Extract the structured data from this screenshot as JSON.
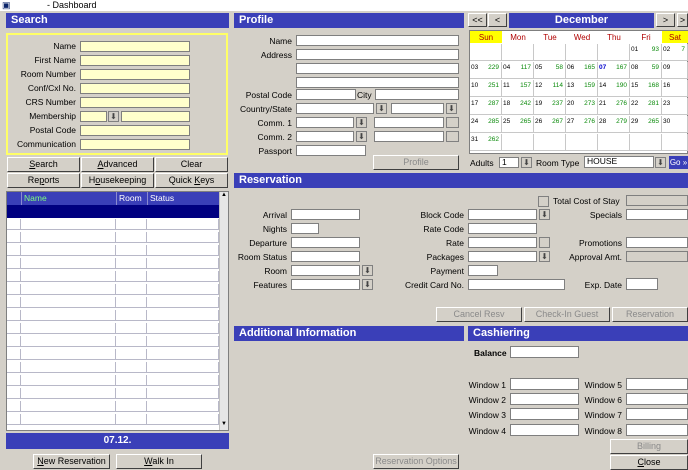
{
  "window": {
    "title": "- Dashboard"
  },
  "search": {
    "header": "Search",
    "labels": [
      "Name",
      "First Name",
      "Room Number",
      "Conf/Cxl No.",
      "CRS Number",
      "Membership",
      "Postal Code",
      "Communication"
    ],
    "buttons": {
      "search": "Search",
      "advanced": "Advanced",
      "clear": "Clear",
      "reports": "Reports",
      "housekeeping": "Housekeeping",
      "quick_keys": "Quick Keys"
    },
    "columns": [
      "Name",
      "Room",
      "Status"
    ],
    "date_bar": "07.12.",
    "new_reservation": "New Reservation",
    "walk_in": "Walk In"
  },
  "profile": {
    "header": "Profile",
    "labels": {
      "name": "Name",
      "address": "Address",
      "postal_code": "Postal Code",
      "city": "City",
      "country_state": "Country/State",
      "comm1": "Comm. 1",
      "comm2": "Comm. 2",
      "passport": "Passport"
    },
    "button": "Profile"
  },
  "calendar": {
    "prev_prev": "<<",
    "prev": "<",
    "month": "December",
    "next": ">",
    "next_next": ">",
    "dow": [
      "Sun",
      "Mon",
      "Tue",
      "Wed",
      "Thu",
      "Fri",
      "Sat"
    ],
    "weeks": [
      [
        [
          "",
          ""
        ],
        [
          "",
          ""
        ],
        [
          "",
          ""
        ],
        [
          "",
          ""
        ],
        [
          "",
          ""
        ],
        [
          "01",
          "93"
        ],
        [
          "02",
          "7"
        ]
      ],
      [
        [
          "03",
          "229"
        ],
        [
          "04",
          "117"
        ],
        [
          "05",
          "58"
        ],
        [
          "06",
          "165"
        ],
        [
          "07",
          "167"
        ],
        [
          "08",
          "59"
        ],
        [
          "09",
          ""
        ]
      ],
      [
        [
          "10",
          "251"
        ],
        [
          "11",
          "157"
        ],
        [
          "12",
          "114"
        ],
        [
          "13",
          "159"
        ],
        [
          "14",
          "190"
        ],
        [
          "15",
          "168"
        ],
        [
          "16",
          ""
        ]
      ],
      [
        [
          "17",
          "287"
        ],
        [
          "18",
          "242"
        ],
        [
          "19",
          "237"
        ],
        [
          "20",
          "273"
        ],
        [
          "21",
          "276"
        ],
        [
          "22",
          "281"
        ],
        [
          "23",
          ""
        ]
      ],
      [
        [
          "24",
          "285"
        ],
        [
          "25",
          "265"
        ],
        [
          "26",
          "267"
        ],
        [
          "27",
          "276"
        ],
        [
          "28",
          "279"
        ],
        [
          "29",
          "265"
        ],
        [
          "30",
          ""
        ]
      ],
      [
        [
          "31",
          "262"
        ],
        [
          "",
          ""
        ],
        [
          "",
          ""
        ],
        [
          "",
          ""
        ],
        [
          "",
          ""
        ],
        [
          "",
          ""
        ],
        [
          "",
          ""
        ]
      ]
    ],
    "adults_label": "Adults",
    "adults_value": "1",
    "room_type_label": "Room Type",
    "room_type_value": "HOUSE",
    "go": "Go »"
  },
  "reservation": {
    "header": "Reservation",
    "labels": {
      "total_cost": "Total Cost of Stay",
      "arrival": "Arrival",
      "block_code": "Block Code",
      "specials": "Specials",
      "nights": "Nights",
      "rate_code": "Rate Code",
      "departure": "Departure",
      "rate": "Rate",
      "promotions": "Promotions",
      "room_status": "Room Status",
      "packages": "Packages",
      "approval_amt": "Approval Amt.",
      "room": "Room",
      "payment": "Payment",
      "features": "Features",
      "credit_card": "Credit Card No.",
      "exp_date": "Exp. Date"
    },
    "buttons": {
      "cancel": "Cancel Resv",
      "checkin": "Check-In Guest",
      "reservation": "Reservation"
    }
  },
  "additional": {
    "header": "Additional Information",
    "button": "Reservation Options"
  },
  "cashiering": {
    "header": "Cashiering",
    "balance": "Balance",
    "windows": [
      "Window 1",
      "Window 2",
      "Window 3",
      "Window 4",
      "Window 5",
      "Window 6",
      "Window 7",
      "Window 8"
    ],
    "billing": "Billing",
    "close": "Close"
  }
}
